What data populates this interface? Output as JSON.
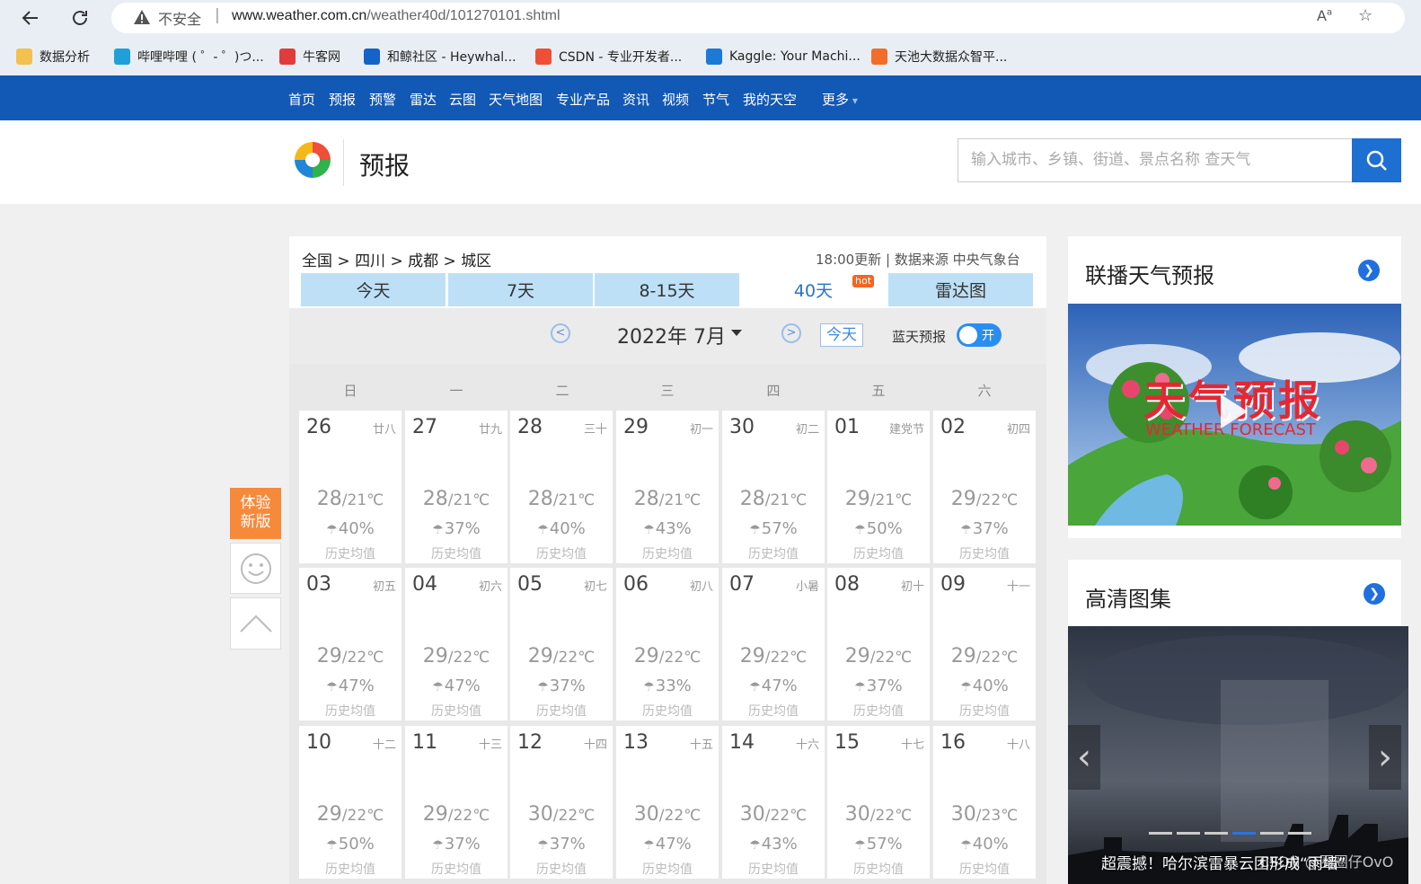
{
  "browser": {
    "security_label": "不安全",
    "url_host": "www.weather.com.cn",
    "url_path": "/weather40d/101270101.shtml",
    "bookmarks": [
      {
        "label": "数据分析",
        "icon": "folder-icon"
      },
      {
        "label": "哔哩哔哩 ( ゜- ゜)つ...",
        "icon": "bilibili-icon"
      },
      {
        "label": "牛客网",
        "icon": "nowcoder-icon"
      },
      {
        "label": "和鲸社区 - Heywhal...",
        "icon": "heywhale-icon"
      },
      {
        "label": "CSDN - 专业开发者...",
        "icon": "csdn-icon"
      },
      {
        "label": "Kaggle: Your Machi...",
        "icon": "kaggle-icon"
      },
      {
        "label": "天池大数据众智平...",
        "icon": "tianchi-icon"
      }
    ]
  },
  "nav": {
    "items": [
      "首页",
      "预报",
      "预警",
      "雷达",
      "云图",
      "天气地图",
      "专业产品",
      "资讯",
      "视频",
      "节气",
      "我的天空"
    ],
    "more": "更多"
  },
  "header": {
    "title": "预报",
    "search_placeholder": "输入城市、乡镇、街道、景点名称 查天气"
  },
  "breadcrumb": {
    "parts": [
      "全国",
      "四川",
      "成都",
      "城区"
    ],
    "sep": " > "
  },
  "update_info": "18:00更新 | 数据来源 中央气象台",
  "tabs": [
    {
      "label": "今天"
    },
    {
      "label": "7天"
    },
    {
      "label": "8-15天"
    },
    {
      "label": "40天",
      "badge": "hot"
    },
    {
      "label": "雷达图"
    }
  ],
  "calendar": {
    "prev": "<",
    "next": ">",
    "month_label": "2022年 7月",
    "today_button": "今天",
    "bluesky_label": "蓝天预报",
    "toggle_label": "开",
    "weekdays": [
      "日",
      "一",
      "二",
      "三",
      "四",
      "五",
      "六"
    ],
    "history_label": "历史均值",
    "unit": "℃",
    "days": [
      {
        "d": "26",
        "lunar": "廿八",
        "hi": "28",
        "lo": "21",
        "rain": "40%"
      },
      {
        "d": "27",
        "lunar": "廿九",
        "hi": "28",
        "lo": "21",
        "rain": "37%"
      },
      {
        "d": "28",
        "lunar": "三十",
        "hi": "28",
        "lo": "21",
        "rain": "40%"
      },
      {
        "d": "29",
        "lunar": "初一",
        "hi": "28",
        "lo": "21",
        "rain": "43%"
      },
      {
        "d": "30",
        "lunar": "初二",
        "hi": "28",
        "lo": "21",
        "rain": "57%"
      },
      {
        "d": "01",
        "lunar": "建党节",
        "hi": "29",
        "lo": "21",
        "rain": "50%"
      },
      {
        "d": "02",
        "lunar": "初四",
        "hi": "29",
        "lo": "22",
        "rain": "37%"
      },
      {
        "d": "03",
        "lunar": "初五",
        "hi": "29",
        "lo": "22",
        "rain": "47%"
      },
      {
        "d": "04",
        "lunar": "初六",
        "hi": "29",
        "lo": "22",
        "rain": "47%"
      },
      {
        "d": "05",
        "lunar": "初七",
        "hi": "29",
        "lo": "22",
        "rain": "37%"
      },
      {
        "d": "06",
        "lunar": "初八",
        "hi": "29",
        "lo": "22",
        "rain": "33%"
      },
      {
        "d": "07",
        "lunar": "小暑",
        "hi": "29",
        "lo": "22",
        "rain": "47%"
      },
      {
        "d": "08",
        "lunar": "初十",
        "hi": "29",
        "lo": "22",
        "rain": "37%"
      },
      {
        "d": "09",
        "lunar": "十一",
        "hi": "29",
        "lo": "22",
        "rain": "40%"
      },
      {
        "d": "10",
        "lunar": "十二",
        "hi": "29",
        "lo": "22",
        "rain": "50%"
      },
      {
        "d": "11",
        "lunar": "十三",
        "hi": "29",
        "lo": "22",
        "rain": "37%"
      },
      {
        "d": "12",
        "lunar": "十四",
        "hi": "30",
        "lo": "22",
        "rain": "37%"
      },
      {
        "d": "13",
        "lunar": "十五",
        "hi": "30",
        "lo": "22",
        "rain": "47%"
      },
      {
        "d": "14",
        "lunar": "十六",
        "hi": "30",
        "lo": "22",
        "rain": "43%"
      },
      {
        "d": "15",
        "lunar": "十七",
        "hi": "30",
        "lo": "22",
        "rain": "57%"
      },
      {
        "d": "16",
        "lunar": "十八",
        "hi": "30",
        "lo": "23",
        "rain": "40%"
      }
    ]
  },
  "floating": {
    "new_version": "体验\n新版"
  },
  "sidebar": {
    "video_title": "联播天气预报",
    "video_overlay_title": "天气预报",
    "video_overlay_sub": "WEATHER FORECAST",
    "gallery_title": "高清图集",
    "gallery_caption": "超震撼！哈尔滨雷暴云团形成“雨墙”",
    "watermark": "CSDN @圈圈仔OvO"
  },
  "colors": {
    "nav_blue": "#1258b5",
    "tab_bg": "#bde0f6",
    "accent": "#2a73c7",
    "orange": "#f7893b"
  }
}
